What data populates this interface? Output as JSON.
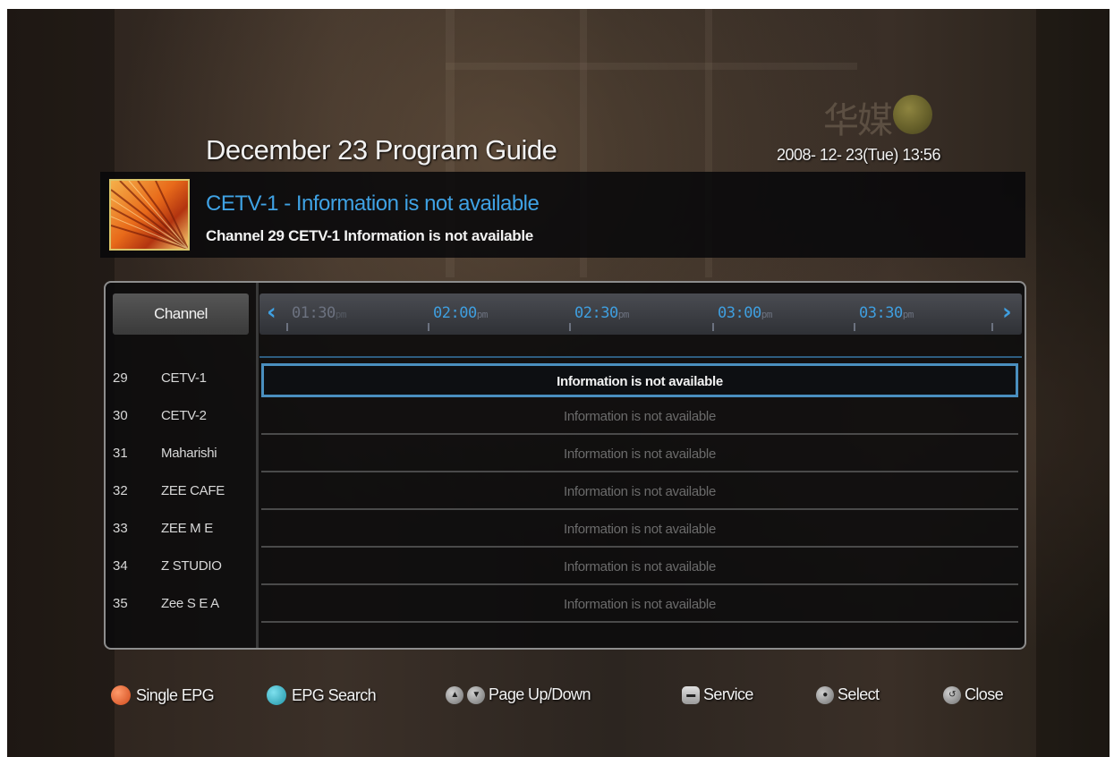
{
  "header": {
    "title": "December 23 Program Guide",
    "datetime": "2008- 12- 23(Tue) 13:56",
    "watermark": "华媒"
  },
  "info": {
    "title": "CETV-1 - Information is not available",
    "subtitle": "Channel 29 CETV-1 Information is not available"
  },
  "guide": {
    "channel_header": "Channel",
    "time_slots": [
      {
        "time": "01:30",
        "suffix": "pm"
      },
      {
        "time": "02:00",
        "suffix": "pm"
      },
      {
        "time": "02:30",
        "suffix": "pm"
      },
      {
        "time": "03:00",
        "suffix": "pm"
      },
      {
        "time": "03:30",
        "suffix": "pm"
      }
    ],
    "rows": [
      {
        "number": "29",
        "name": "CETV-1",
        "program": "Information is not available"
      },
      {
        "number": "30",
        "name": "CETV-2",
        "program": "Information is not available"
      },
      {
        "number": "31",
        "name": "Maharishi",
        "program": "Information is not available"
      },
      {
        "number": "32",
        "name": "ZEE CAFE",
        "program": "Information is not available"
      },
      {
        "number": "33",
        "name": "ZEE M E",
        "program": "Information is not available"
      },
      {
        "number": "34",
        "name": "Z STUDIO",
        "program": "Information is not available"
      },
      {
        "number": "35",
        "name": "Zee S E A",
        "program": "Information is not available"
      }
    ]
  },
  "footer": {
    "single_epg": "Single EPG",
    "epg_search": "EPG Search",
    "page_up_down": "Page Up/Down",
    "service": "Service",
    "select": "Select",
    "close": "Close"
  },
  "colors": {
    "accent_blue": "#3f9fe0",
    "red_key": "#d04a1c",
    "cyan_key": "#1f95a8"
  }
}
